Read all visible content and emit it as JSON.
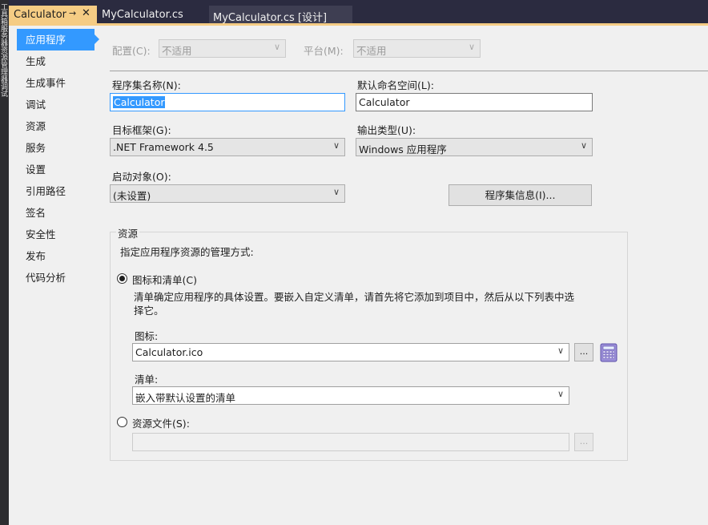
{
  "tabs": [
    {
      "label": "Calculator",
      "pin": "→",
      "close": "✕"
    },
    {
      "label": "MyCalculator.cs"
    },
    {
      "label": "MyCalculator.cs [设计]"
    }
  ],
  "side_strip": {
    "label": "工具箱服务器资源管理器调试"
  },
  "nav": {
    "items": [
      "应用程序",
      "生成",
      "生成事件",
      "调试",
      "资源",
      "服务",
      "设置",
      "引用路径",
      "签名",
      "安全性",
      "发布",
      "代码分析"
    ],
    "selected": 0
  },
  "config": {
    "label": "配置(C):",
    "value": "不适用"
  },
  "platform": {
    "label": "平台(M):",
    "value": "不适用"
  },
  "assembly_name": {
    "label": "程序集名称(N):",
    "value": "Calculator"
  },
  "default_namespace": {
    "label": "默认命名空间(L):",
    "value": "Calculator"
  },
  "target_framework": {
    "label": "目标框架(G):",
    "value": ".NET Framework 4.5"
  },
  "output_type": {
    "label": "输出类型(U):",
    "value": "Windows 应用程序"
  },
  "startup_object": {
    "label": "启动对象(O):",
    "value": "(未设置)"
  },
  "assembly_info_button": "程序集信息(I)...",
  "resources": {
    "title": "资源",
    "description": "指定应用程序资源的管理方式:",
    "icon_manifest_radio": "图标和清单(C)",
    "icon_manifest_note": "清单确定应用程序的具体设置。要嵌入自定义清单，请首先将它添加到项目中，然后从以下列表中选择它。",
    "icon_label": "图标:",
    "icon_value": "Calculator.ico",
    "manifest_label": "清单:",
    "manifest_value": "嵌入带默认设置的清单",
    "resource_file_radio": "资源文件(S):",
    "resource_file_value": "",
    "browse_label": "...",
    "selected_option": "icon_manifest"
  },
  "colors": {
    "accent": "#3399ff",
    "tab_active": "#f5cc84",
    "background": "#f0f0f0"
  },
  "icons": {
    "chevron": "∨",
    "calculator": "calculator-icon"
  }
}
